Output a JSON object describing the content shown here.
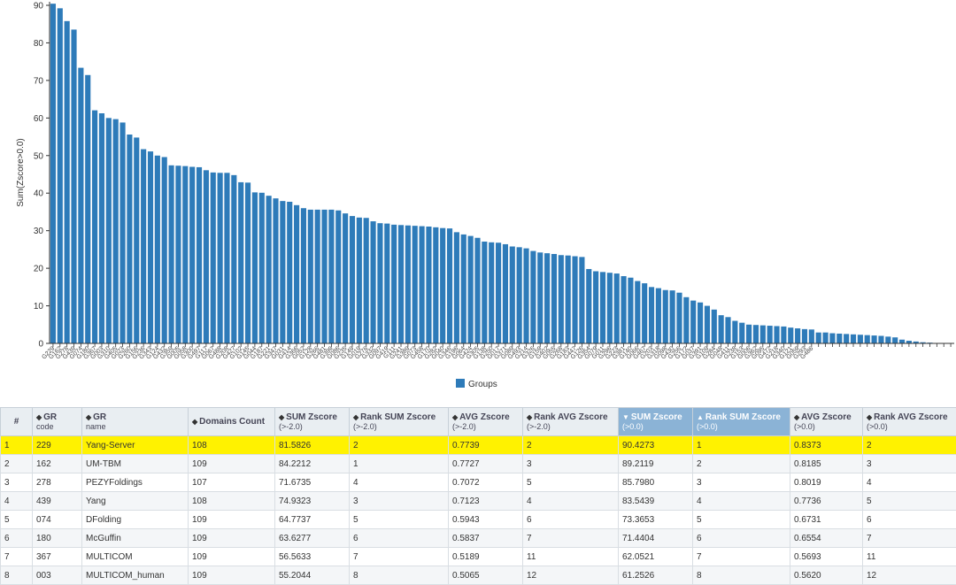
{
  "chart_data": {
    "type": "bar",
    "ylabel": "Sum(Zscore>0.0)",
    "ylim": [
      0,
      90
    ],
    "yticks": [
      0,
      10,
      20,
      30,
      40,
      50,
      60,
      70,
      80,
      90
    ],
    "legend": {
      "label": "Groups",
      "position": "bottom-center"
    },
    "bar_color": "#2e7bb9",
    "categories": [
      "G229",
      "G162",
      "G278",
      "G439",
      "G074",
      "G180",
      "G367",
      "G003",
      "G310",
      "G405",
      "G023",
      "G260",
      "G156",
      "G236",
      "G343",
      "G124",
      "G432",
      "G359",
      "G005",
      "G058",
      "G300",
      "G497",
      "G117",
      "G067",
      "G488",
      "G208",
      "G427",
      "G102",
      "G145",
      "G044",
      "G187",
      "G221",
      "G347",
      "G031",
      "G414",
      "G366",
      "G052",
      "G128",
      "G266",
      "G481",
      "G399",
      "G086",
      "G235",
      "G149",
      "G019",
      "G276",
      "G332",
      "G097",
      "G419",
      "G111",
      "G241",
      "G389",
      "G073",
      "G458",
      "G170",
      "G282",
      "G040",
      "G346",
      "G196",
      "G064",
      "G424",
      "G305",
      "G138",
      "G250",
      "G017",
      "G371",
      "G089",
      "G493",
      "G214",
      "G326",
      "G159",
      "G402",
      "G055",
      "G268",
      "G183",
      "G447",
      "G126",
      "G354",
      "G079",
      "G011",
      "G296",
      "G223",
      "G381",
      "G140",
      "G066",
      "G467",
      "G203",
      "G318",
      "G098",
      "G430",
      "G256",
      "G172",
      "G037",
      "G391",
      "G109",
      "G284",
      "G048",
      "G411",
      "G238",
      "G153",
      "G006",
      "G362",
      "G095",
      "G472",
      "G218",
      "G340",
      "G121",
      "G059",
      "G293",
      "G486"
    ],
    "values": [
      90.43,
      89.21,
      85.8,
      83.54,
      73.37,
      71.44,
      62.05,
      61.25,
      60.0,
      59.7,
      58.8,
      55.6,
      54.8,
      51.7,
      51.1,
      50.0,
      49.6,
      47.4,
      47.3,
      47.2,
      47.0,
      46.9,
      46.1,
      45.5,
      45.4,
      45.4,
      44.8,
      42.9,
      42.8,
      40.2,
      40.1,
      39.3,
      38.6,
      37.9,
      37.7,
      36.8,
      36.0,
      35.6,
      35.6,
      35.6,
      35.6,
      35.4,
      34.6,
      33.9,
      33.5,
      33.4,
      32.5,
      32.0,
      31.9,
      31.6,
      31.5,
      31.4,
      31.3,
      31.2,
      31.1,
      30.9,
      30.7,
      30.6,
      29.6,
      29.0,
      28.6,
      28.1,
      27.1,
      26.9,
      26.8,
      26.4,
      25.8,
      25.6,
      25.3,
      24.6,
      24.2,
      24.0,
      23.8,
      23.5,
      23.4,
      23.2,
      23.0,
      19.8,
      19.2,
      19.0,
      18.8,
      18.6,
      17.9,
      17.5,
      16.6,
      16.0,
      15.0,
      14.7,
      14.2,
      14.1,
      13.5,
      12.3,
      11.4,
      10.9,
      10.0,
      9.0,
      7.5,
      7.0,
      6.0,
      5.5,
      5.0,
      4.9,
      4.8,
      4.7,
      4.6,
      4.5,
      4.2,
      4.0,
      3.8,
      3.7,
      2.9,
      2.9,
      2.7,
      2.6,
      2.5,
      2.4,
      2.3,
      2.2,
      2.1,
      2.0,
      1.8,
      1.6,
      1.0,
      0.7,
      0.5,
      0.3,
      0.2,
      0.1,
      0.1,
      0.05
    ]
  },
  "table": {
    "headers": [
      {
        "label": "#",
        "sub": "",
        "sort": ""
      },
      {
        "label": "GR",
        "sub": "code",
        "sort": "◆"
      },
      {
        "label": "GR",
        "sub": "name",
        "sort": "◆"
      },
      {
        "label": "Domains Count",
        "sub": "",
        "sort": "◆"
      },
      {
        "label": "SUM Zscore",
        "sub": "(>-2.0)",
        "sort": "◆"
      },
      {
        "label": "Rank SUM Zscore",
        "sub": "(>-2.0)",
        "sort": "◆"
      },
      {
        "label": "AVG Zscore",
        "sub": "(>-2.0)",
        "sort": "◆"
      },
      {
        "label": "Rank AVG Zscore",
        "sub": "(>-2.0)",
        "sort": "◆"
      },
      {
        "label": "SUM Zscore",
        "sub": "(>0.0)",
        "sort": "▼"
      },
      {
        "label": "Rank SUM Zscore",
        "sub": "(>0.0)",
        "sort": "▲"
      },
      {
        "label": "AVG Zscore",
        "sub": "(>0.0)",
        "sort": "◆"
      },
      {
        "label": "Rank AVG Zscore",
        "sub": "(>0.0)",
        "sort": "◆"
      }
    ],
    "rows": [
      [
        "1",
        "229",
        "Yang-Server",
        "108",
        "81.5826",
        "2",
        "0.7739",
        "2",
        "90.4273",
        "1",
        "0.8373",
        "2"
      ],
      [
        "2",
        "162",
        "UM-TBM",
        "109",
        "84.2212",
        "1",
        "0.7727",
        "3",
        "89.2119",
        "2",
        "0.8185",
        "3"
      ],
      [
        "3",
        "278",
        "PEZYFoldings",
        "107",
        "71.6735",
        "4",
        "0.7072",
        "5",
        "85.7980",
        "3",
        "0.8019",
        "4"
      ],
      [
        "4",
        "439",
        "Yang",
        "108",
        "74.9323",
        "3",
        "0.7123",
        "4",
        "83.5439",
        "4",
        "0.7736",
        "5"
      ],
      [
        "5",
        "074",
        "DFolding",
        "109",
        "64.7737",
        "5",
        "0.5943",
        "6",
        "73.3653",
        "5",
        "0.6731",
        "6"
      ],
      [
        "6",
        "180",
        "McGuffin",
        "109",
        "63.6277",
        "6",
        "0.5837",
        "7",
        "71.4404",
        "6",
        "0.6554",
        "7"
      ],
      [
        "7",
        "367",
        "MULTICOM",
        "109",
        "56.5633",
        "7",
        "0.5189",
        "11",
        "62.0521",
        "7",
        "0.5693",
        "11"
      ],
      [
        "8",
        "003",
        "MULTICOM_human",
        "109",
        "55.2044",
        "8",
        "0.5065",
        "12",
        "61.2526",
        "8",
        "0.5620",
        "12"
      ]
    ]
  }
}
